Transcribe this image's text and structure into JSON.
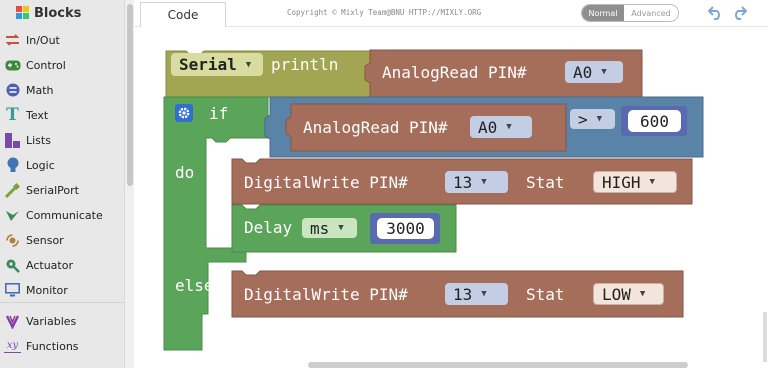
{
  "sidebar": {
    "title": "Blocks",
    "items": [
      {
        "label": "In/Out",
        "icon": "in-out-icon",
        "color": "#c0553a"
      },
      {
        "label": "Control",
        "icon": "gamepad-icon",
        "color": "#3b8a3b"
      },
      {
        "label": "Math",
        "icon": "math-icon",
        "color": "#4f5fb0"
      },
      {
        "label": "Text",
        "icon": "text-icon",
        "color": "#3a9a9a"
      },
      {
        "label": "Lists",
        "icon": "lists-icon",
        "color": "#7a4aa8"
      },
      {
        "label": "Logic",
        "icon": "bulb-icon",
        "color": "#3e78b4"
      },
      {
        "label": "SerialPort",
        "icon": "serial-port-icon",
        "color": "#7da33a"
      },
      {
        "label": "Communicate",
        "icon": "communicate-icon",
        "color": "#3a8a5a"
      },
      {
        "label": "Sensor",
        "icon": "sensor-icon",
        "color": "#b08040"
      },
      {
        "label": "Actuator",
        "icon": "actuator-icon",
        "color": "#3a8a5a"
      },
      {
        "label": "Monitor",
        "icon": "monitor-icon",
        "color": "#3e6ab4"
      },
      {
        "label": "Variables",
        "icon": "variables-icon",
        "color": "#8a3aa8"
      },
      {
        "label": "Functions",
        "icon": "functions-icon",
        "color": "#7a4aa8"
      }
    ]
  },
  "topbar": {
    "tab": "Code",
    "copyright": "Copyright © Mixly Team@BNU HTTP://MIXLY.ORG",
    "mode_normal": "Normal",
    "mode_advanced": "Advanced"
  },
  "workspace": {
    "serial_block": {
      "port": "Serial",
      "method": "println",
      "analog": "AnalogRead PIN#",
      "pin": "A0"
    },
    "if_block": {
      "if_label": "if",
      "do_label": "do",
      "else_label": "else",
      "condition": {
        "analog": "AnalogRead PIN#",
        "pin": "A0",
        "operator": ">",
        "value": "600"
      },
      "do_statements": {
        "digital_write": {
          "label": "DigitalWrite PIN#",
          "pin": "13",
          "stat_label": "Stat",
          "stat": "HIGH"
        },
        "delay": {
          "label": "Delay",
          "unit": "ms",
          "value": "3000"
        }
      },
      "else_statements": {
        "digital_write": {
          "label": "DigitalWrite PIN#",
          "pin": "13",
          "stat_label": "Stat",
          "stat": "LOW"
        }
      }
    }
  },
  "colors": {
    "serial_block": "#a2a551",
    "io_block": "#a46e5b",
    "logic_block": "#5a83a8",
    "control_block": "#5ba55b",
    "dropdown_inner": "#c3cee4"
  }
}
